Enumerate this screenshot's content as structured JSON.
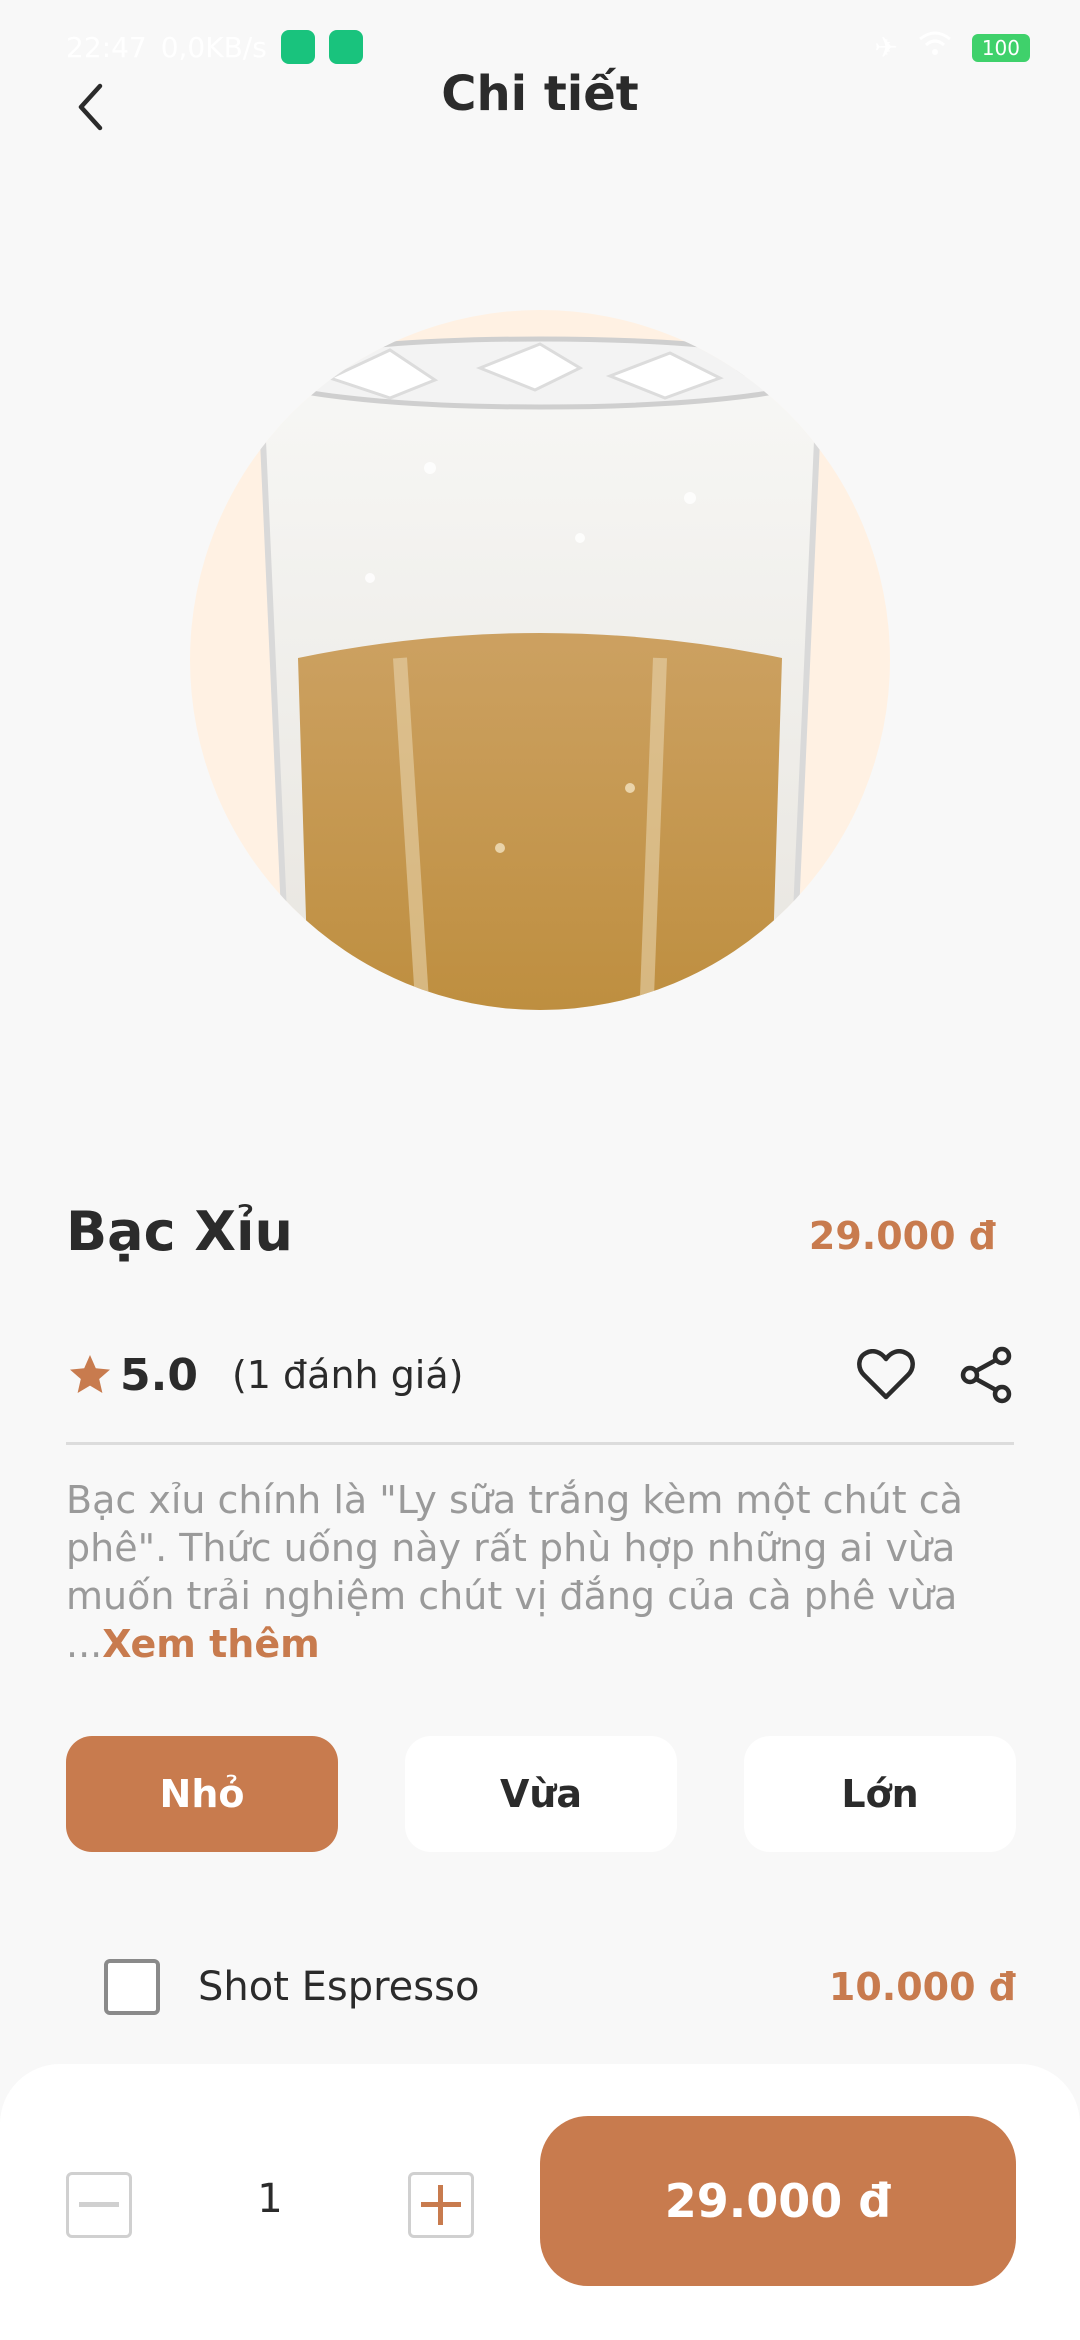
{
  "status_bar": {
    "time": "22:47",
    "network": "0,0KB/s",
    "battery": "100"
  },
  "header": {
    "title": "Chi tiết"
  },
  "product": {
    "name": "Bạc Xỉu",
    "price": "29.000 đ",
    "rating": "5.0",
    "rating_count": "(1 đánh giá)",
    "description": "Bạc xỉu chính là \"Ly sữa trắng kèm một chút cà phê\". Thức uống này rất phù hợp những ai vừa muốn trải nghiệm chút vị đắng của cà phê vừa",
    "see_more_prefix": "...",
    "see_more": "Xem thêm"
  },
  "sizes": [
    {
      "label": "Nhỏ",
      "selected": true
    },
    {
      "label": "Vừa",
      "selected": false
    },
    {
      "label": "Lớn",
      "selected": false
    }
  ],
  "extras": [
    {
      "name": "Shot Espresso",
      "price": "10.000 đ",
      "checked": false
    }
  ],
  "cart": {
    "quantity": "1",
    "total_label": "29.000 đ"
  },
  "colors": {
    "accent": "#c87b4e",
    "hero_circle": "#fff1e3",
    "background": "#f8f8f8"
  }
}
